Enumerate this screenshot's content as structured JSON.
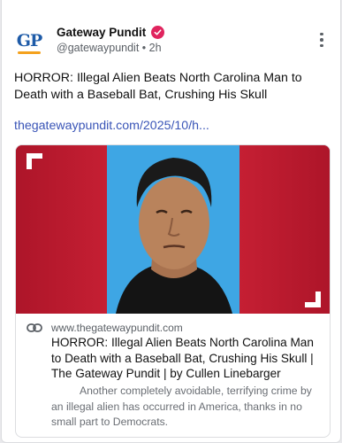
{
  "account": {
    "avatar_text": "GP",
    "display_name": "Gateway Pundit",
    "handle": "@gatewaypundit",
    "separator": "•",
    "time": "2h",
    "verified": true,
    "badge_color": "#e0245e"
  },
  "post": {
    "text": "HORROR: Illegal Alien Beats North Carolina Man to Death with a Baseball Bat, Crushing His Skull",
    "link": "thegatewaypundit.com/2025/10/h..."
  },
  "preview": {
    "domain": "www.thegatewaypundit.com",
    "title": "HORROR: Illegal Alien Beats North Carolina Man to Death with a Baseball Bat, Crushing His Skull | The Gateway Pundit | by Cullen Linebarger",
    "description": "Another completely avoidable, terrifying crime by an illegal alien has occurred in America, thanks in no small part to Democrats.",
    "image_colors": {
      "frame": "#c51f33",
      "backdrop": "#3ea6e4"
    }
  },
  "icons": {
    "menu": "more-vertical-icon",
    "verified": "verified-badge-icon",
    "link": "link-icon"
  },
  "colors": {
    "link": "#3a55b7",
    "brand_blue": "#1e5ba8",
    "brand_orange": "#f4a11d"
  }
}
